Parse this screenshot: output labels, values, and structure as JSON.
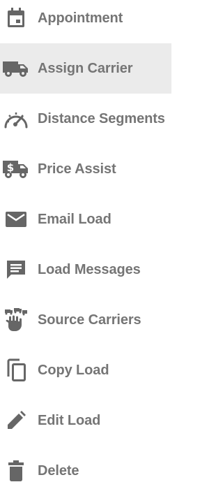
{
  "menu": {
    "icon_color": "#666666",
    "label_color": "#757575",
    "active_background": "#ebebeb",
    "items": [
      {
        "label": "Appointment",
        "icon": "calendar-icon",
        "active": false
      },
      {
        "label": "Assign Carrier",
        "icon": "truck-icon",
        "active": true
      },
      {
        "label": "Distance Segments",
        "icon": "speedometer-icon",
        "active": false
      },
      {
        "label": "Price Assist",
        "icon": "dollar-truck-icon",
        "active": false
      },
      {
        "label": "Email Load",
        "icon": "envelope-icon",
        "active": false
      },
      {
        "label": "Load Messages",
        "icon": "message-icon",
        "active": false
      },
      {
        "label": "Source Carriers",
        "icon": "hand-trucks-icon",
        "active": false
      },
      {
        "label": "Copy Load",
        "icon": "copy-icon",
        "active": false
      },
      {
        "label": "Edit Load",
        "icon": "pencil-icon",
        "active": false
      },
      {
        "label": "Delete",
        "icon": "trash-icon",
        "active": false
      }
    ]
  }
}
